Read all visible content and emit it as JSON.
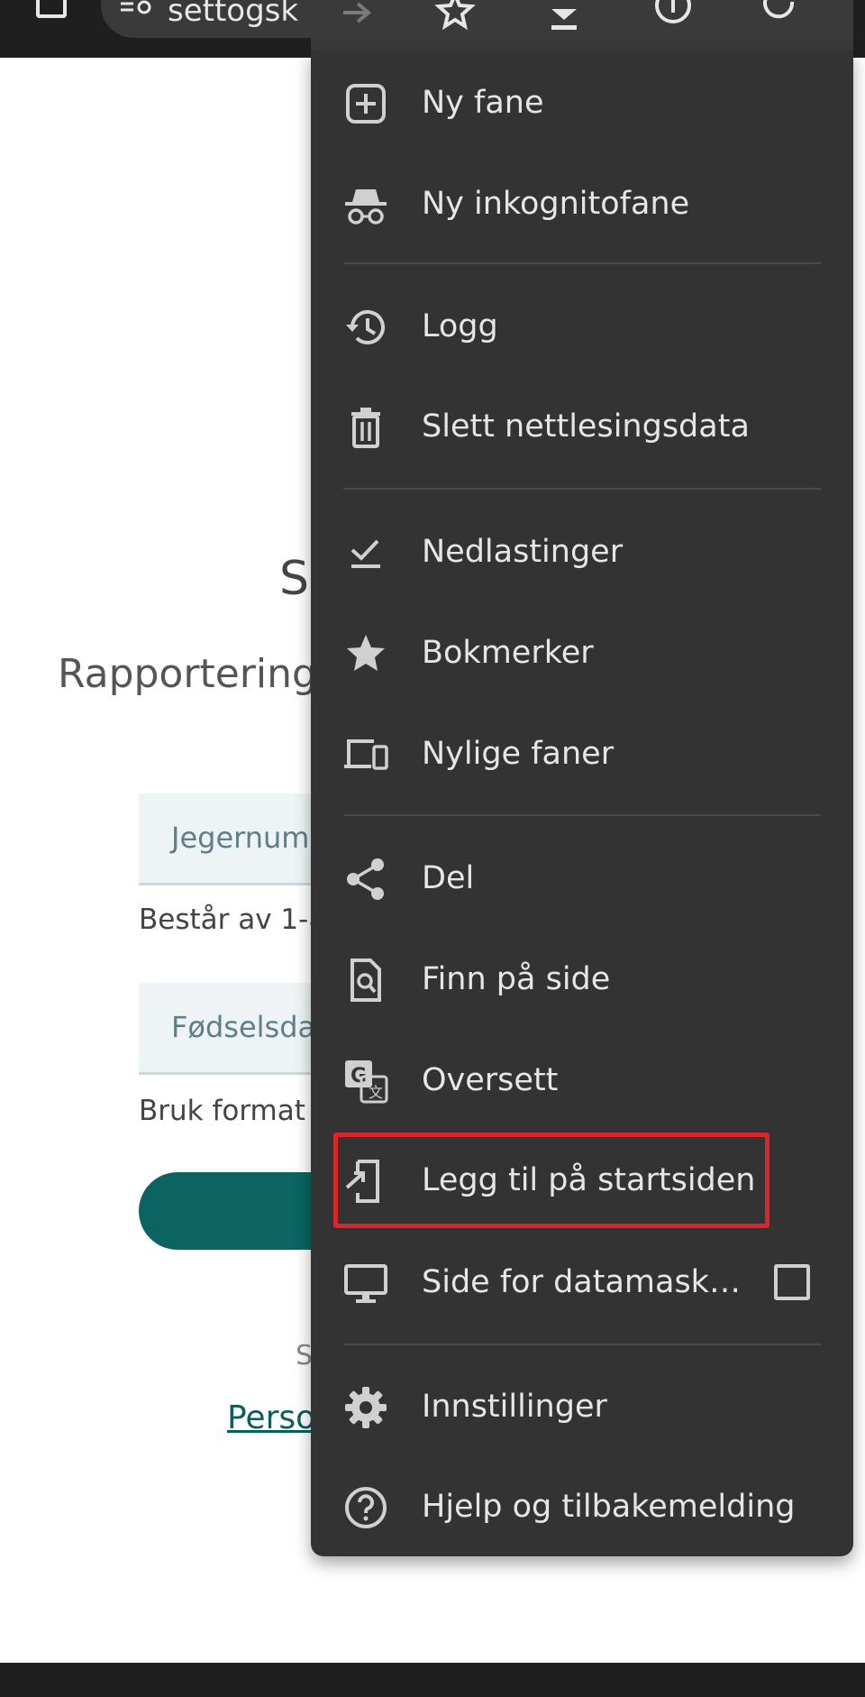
{
  "browser": {
    "url_text": "settogsk"
  },
  "page": {
    "heading": "S",
    "subheading": "Rapportering",
    "hunter_field_placeholder": "Jegernumm",
    "hunter_field_help": "Består av 1-8",
    "birth_field_placeholder": "Fødselsda",
    "birth_field_help": "Bruk format",
    "small_text": "S",
    "privacy_link": "Perso"
  },
  "menu": {
    "items": [
      {
        "label": "Ny fane",
        "icon": "new-tab-icon"
      },
      {
        "label": "Ny inkognitofane",
        "icon": "incognito-icon"
      },
      {
        "label": "Logg",
        "icon": "history-icon"
      },
      {
        "label": "Slett nettlesingsdata",
        "icon": "trash-icon"
      },
      {
        "label": "Nedlastinger",
        "icon": "downloads-icon"
      },
      {
        "label": "Bokmerker",
        "icon": "star-icon"
      },
      {
        "label": "Nylige faner",
        "icon": "devices-icon"
      },
      {
        "label": "Del",
        "icon": "share-icon"
      },
      {
        "label": "Finn på side",
        "icon": "find-in-page-icon"
      },
      {
        "label": "Oversett",
        "icon": "translate-icon"
      },
      {
        "label": "Legg til på startsiden",
        "icon": "add-to-home-icon"
      },
      {
        "label": "Side for datamask…",
        "icon": "desktop-icon",
        "checked": false
      },
      {
        "label": "Innstillinger",
        "icon": "gear-icon"
      },
      {
        "label": "Hjelp og tilbakemelding",
        "icon": "help-icon"
      }
    ]
  },
  "colors": {
    "menu_background": "#333333",
    "menu_text": "#e6e6e6",
    "highlight": "#d8262c",
    "accent": "#0b6461"
  }
}
